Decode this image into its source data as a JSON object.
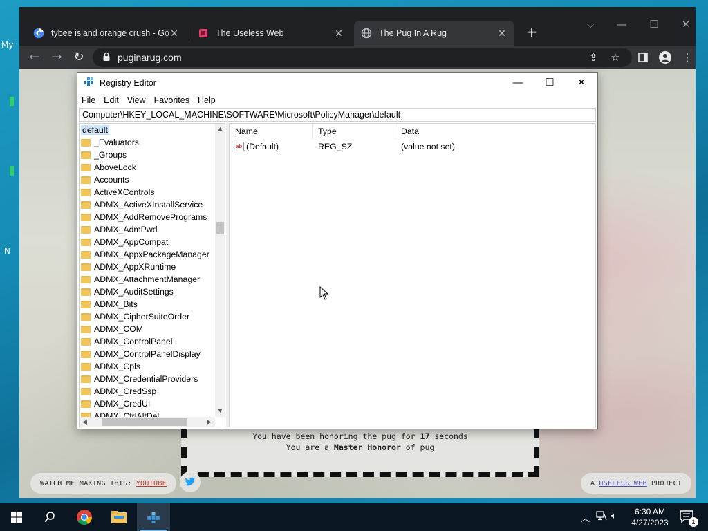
{
  "desktop": {
    "fragments": [
      "My",
      "N"
    ]
  },
  "browser": {
    "tabs": [
      {
        "title": "tybee island orange crush - Goo",
        "icon": "google-icon",
        "active": false
      },
      {
        "title": "The Useless Web",
        "icon": "useless-web-icon",
        "active": false
      },
      {
        "title": "The Pug In A Rug",
        "icon": "globe-icon",
        "active": true
      }
    ],
    "url": "puginarug.com"
  },
  "page": {
    "honor_line1_prefix": "You have been honoring the pug for ",
    "honor_seconds": "17",
    "honor_line1_suffix": " seconds",
    "honor_line2_prefix": "You are a ",
    "honor_rank": "Master Honoror",
    "honor_line2_suffix": " of pug",
    "watch_text": "WATCH ME MAKING THIS:",
    "watch_link": "YOUTUBE",
    "project_prefix": "A",
    "project_link": "USELESS WEB",
    "project_suffix": "PROJECT"
  },
  "regedit": {
    "title": "Registry Editor",
    "menu": [
      "File",
      "Edit",
      "View",
      "Favorites",
      "Help"
    ],
    "address": "Computer\\HKEY_LOCAL_MACHINE\\SOFTWARE\\Microsoft\\PolicyManager\\default",
    "tree_root": "default",
    "tree_items": [
      "_Evaluators",
      "_Groups",
      "AboveLock",
      "Accounts",
      "ActiveXControls",
      "ADMX_ActiveXInstallService",
      "ADMX_AddRemovePrograms",
      "ADMX_AdmPwd",
      "ADMX_AppCompat",
      "ADMX_AppxPackageManager",
      "ADMX_AppXRuntime",
      "ADMX_AttachmentManager",
      "ADMX_AuditSettings",
      "ADMX_Bits",
      "ADMX_CipherSuiteOrder",
      "ADMX_COM",
      "ADMX_ControlPanel",
      "ADMX_ControlPanelDisplay",
      "ADMX_Cpls",
      "ADMX_CredentialProviders",
      "ADMX_CredSsp",
      "ADMX_CredUI",
      "ADMX_CtrlAltDel"
    ],
    "columns": {
      "name": "Name",
      "type": "Type",
      "data": "Data"
    },
    "values": [
      {
        "name": "(Default)",
        "type": "REG_SZ",
        "data": "(value not set)"
      }
    ]
  },
  "taskbar": {
    "time": "6:30 AM",
    "date": "4/27/2023",
    "notification_count": "1"
  },
  "colors": {
    "chrome_bg": "#202124",
    "chrome_toolbar": "#35363a",
    "taskbar_bg": "#0a1621",
    "selection": "#cce4f7"
  }
}
